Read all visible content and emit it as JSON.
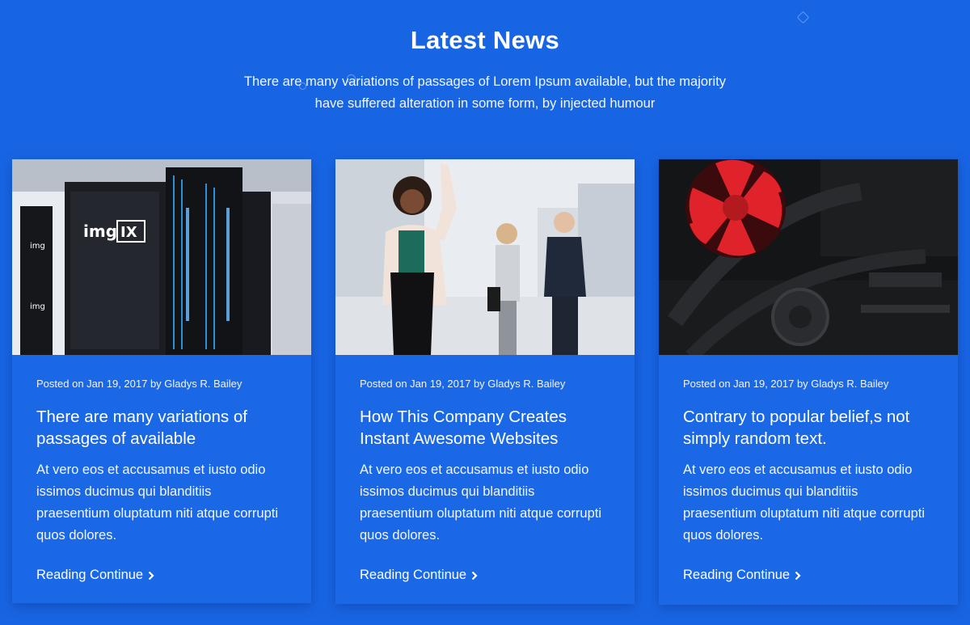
{
  "section": {
    "title": "Latest News",
    "subtitle": "There are many variations of passages of Lorem Ipsum available, but the majority have suffered alteration in some form, by injected humour"
  },
  "posts": [
    {
      "meta": "Posted on Jan 19, 2017 by Gladys R. Bailey",
      "title": "There are many variations of passages of available",
      "excerpt": "At vero eos et accusamus et iusto odio issimos ducimus qui blanditiis praesentium oluptatum niti atque corrupti quos dolores.",
      "link": "Reading Continue",
      "image": {
        "subject": "server-racks",
        "brand_text": "imgIX"
      }
    },
    {
      "meta": "Posted on Jan 19, 2017 by Gladys R. Bailey",
      "title": "How This Company Creates Instant Awesome Websites",
      "excerpt": "At vero eos et accusamus et iusto odio issimos ducimus qui blanditiis praesentium oluptatum niti atque corrupti quos dolores.",
      "link": "Reading Continue",
      "image": {
        "subject": "business-people-outdoors"
      }
    },
    {
      "meta": "Posted on Jan 19, 2017 by Gladys R. Bailey",
      "title": "Contrary to popular belief,s not simply random text.",
      "excerpt": "At vero eos et accusamus et iusto odio issimos ducimus qui blanditiis praesentium oluptatum niti atque corrupti quos dolores.",
      "link": "Reading Continue",
      "image": {
        "subject": "pc-internals-red-fan"
      }
    }
  ],
  "colors": {
    "background": "#1865e3",
    "card": "#1a68e5",
    "text": "#ffffff",
    "fan_red": "#e0232a"
  },
  "icons": {
    "link_arrow": "chevron-right-icon"
  }
}
